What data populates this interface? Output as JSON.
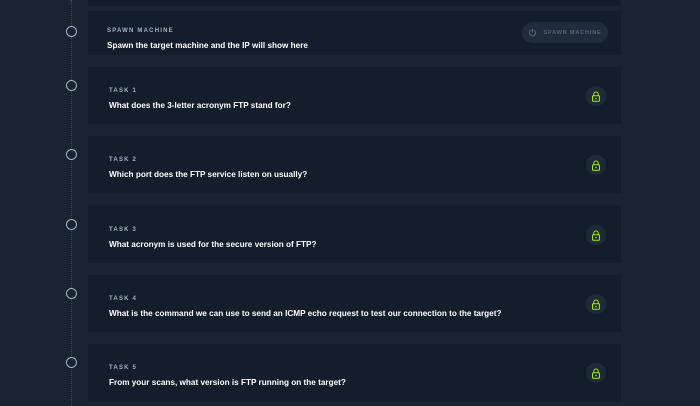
{
  "spawn": {
    "label": "SPAWN MACHINE",
    "title": "Spawn the target machine and the IP will show here",
    "button_label": "SPAWN MACHINE",
    "button_icon": "power-icon"
  },
  "tasks": [
    {
      "label": "TASK 1",
      "question": "What does the 3-letter acronym FTP stand for?",
      "status_icon": "lock-icon"
    },
    {
      "label": "TASK 2",
      "question": "Which port does the FTP service listen on usually?",
      "status_icon": "lock-icon"
    },
    {
      "label": "TASK 3",
      "question": "What acronym is used for the secure version of FTP?",
      "status_icon": "lock-icon"
    },
    {
      "label": "TASK 4",
      "question": "What is the command we can use to send an ICMP echo request to test our connection to the target?",
      "status_icon": "lock-icon"
    },
    {
      "label": "TASK 5",
      "question": "From your scans, what version is FTP running on the target?",
      "status_icon": "lock-icon"
    }
  ],
  "colors": {
    "background": "#1a2332",
    "card": "#141d2b",
    "text": "#ffffff",
    "muted": "#a4b1cd",
    "lock_accent": "#9fef00"
  }
}
